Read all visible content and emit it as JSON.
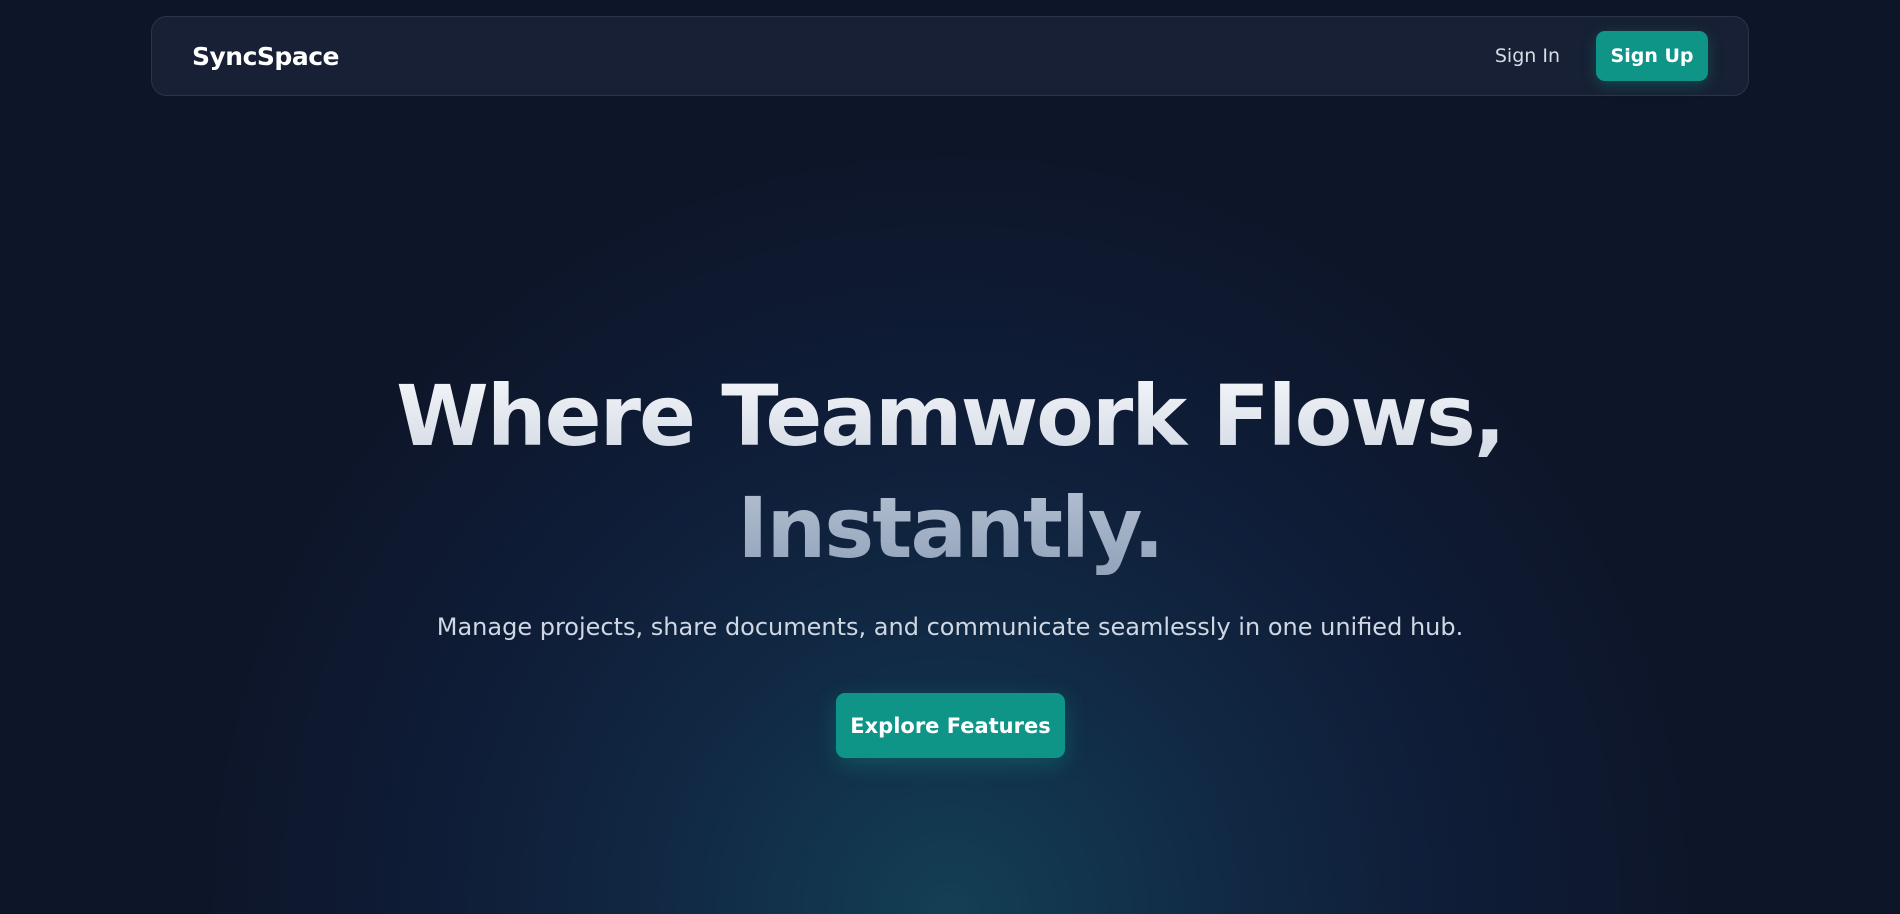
{
  "header": {
    "brand": "SyncSpace",
    "sign_in_label": "Sign In",
    "sign_up_label": "Sign Up"
  },
  "hero": {
    "headline_line1": "Where Teamwork Flows,",
    "headline_line2": "Instantly.",
    "subheadline": "Manage projects, share documents, and communicate seamlessly in one unified hub.",
    "cta_label": "Explore Features"
  },
  "colors": {
    "background": "#0d1528",
    "navbar_background": "#172034",
    "accent": "#0f9488",
    "headline_primary": "#e9edf4",
    "headline_secondary": "#a5b3c9",
    "body_text": "#cfd7e3"
  }
}
